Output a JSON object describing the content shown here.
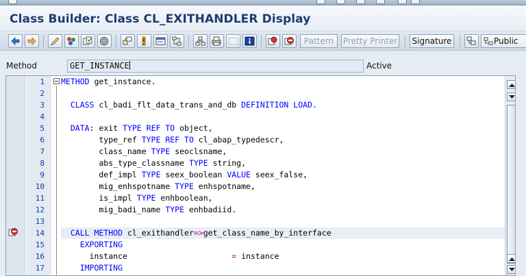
{
  "window": {
    "title": "Class Builder: Class CL_EXITHANDLER Display"
  },
  "toolbar": {
    "pattern_label": "Pattern",
    "pretty_printer_label": "Pretty Printer",
    "signature_label": "Signature",
    "public_label": "Public"
  },
  "method_row": {
    "label": "Method",
    "value": "GET_INSTANCE",
    "status": "Active"
  },
  "editor": {
    "current_line": 14,
    "lines": [
      {
        "no": "1",
        "segments": [
          {
            "t": "kw",
            "v": "METHOD"
          },
          {
            "t": "tx",
            "v": " get_instance."
          }
        ]
      },
      {
        "no": "2",
        "segments": []
      },
      {
        "no": "3",
        "segments": [
          {
            "t": "tx",
            "v": "  "
          },
          {
            "t": "kw",
            "v": "CLASS"
          },
          {
            "t": "tx",
            "v": " cl_badi_flt_data_trans_and_db "
          },
          {
            "t": "kw",
            "v": "DEFINITION LOAD"
          },
          {
            "t": "tx",
            "v": "."
          }
        ]
      },
      {
        "no": "4",
        "segments": []
      },
      {
        "no": "5",
        "segments": [
          {
            "t": "tx",
            "v": "  "
          },
          {
            "t": "kw",
            "v": "DATA"
          },
          {
            "t": "tx",
            "v": ": exit "
          },
          {
            "t": "kw",
            "v": "TYPE REF TO"
          },
          {
            "t": "tx",
            "v": " object,"
          }
        ]
      },
      {
        "no": "6",
        "segments": [
          {
            "t": "tx",
            "v": "        type_ref "
          },
          {
            "t": "kw",
            "v": "TYPE REF TO"
          },
          {
            "t": "tx",
            "v": " cl_abap_typedescr,"
          }
        ]
      },
      {
        "no": "7",
        "segments": [
          {
            "t": "tx",
            "v": "        class_name "
          },
          {
            "t": "kw",
            "v": "TYPE"
          },
          {
            "t": "tx",
            "v": " seoclsname,"
          }
        ]
      },
      {
        "no": "8",
        "segments": [
          {
            "t": "tx",
            "v": "        abs_type_classname "
          },
          {
            "t": "kw",
            "v": "TYPE"
          },
          {
            "t": "tx",
            "v": " string,"
          }
        ]
      },
      {
        "no": "9",
        "segments": [
          {
            "t": "tx",
            "v": "        def_impl "
          },
          {
            "t": "kw",
            "v": "TYPE"
          },
          {
            "t": "tx",
            "v": " seex_boolean "
          },
          {
            "t": "kw",
            "v": "VALUE"
          },
          {
            "t": "tx",
            "v": " seex_false,"
          }
        ]
      },
      {
        "no": "10",
        "segments": [
          {
            "t": "tx",
            "v": "        mig_enhspotname "
          },
          {
            "t": "kw",
            "v": "TYPE"
          },
          {
            "t": "tx",
            "v": " enhspotname,"
          }
        ]
      },
      {
        "no": "11",
        "segments": [
          {
            "t": "tx",
            "v": "        is_impl "
          },
          {
            "t": "kw",
            "v": "TYPE"
          },
          {
            "t": "tx",
            "v": " enhboolean,"
          }
        ]
      },
      {
        "no": "12",
        "segments": [
          {
            "t": "tx",
            "v": "        mig_badi_name "
          },
          {
            "t": "kw",
            "v": "TYPE"
          },
          {
            "t": "tx",
            "v": " enhbadiid."
          }
        ]
      },
      {
        "no": "13",
        "segments": []
      },
      {
        "no": "14",
        "segments": [
          {
            "t": "tx",
            "v": "  "
          },
          {
            "t": "kw",
            "v": "CALL METHOD"
          },
          {
            "t": "tx",
            "v": " cl_exithandler"
          },
          {
            "t": "op",
            "v": "=>"
          },
          {
            "t": "tx",
            "v": "get_class_name_by_interface"
          }
        ]
      },
      {
        "no": "15",
        "segments": [
          {
            "t": "tx",
            "v": "    "
          },
          {
            "t": "kw",
            "v": "EXPORTING"
          }
        ]
      },
      {
        "no": "16",
        "segments": [
          {
            "t": "tx",
            "v": "      instance                      "
          },
          {
            "t": "op",
            "v": "="
          },
          {
            "t": "tx",
            "v": " instance"
          }
        ]
      },
      {
        "no": "17",
        "segments": [
          {
            "t": "tx",
            "v": "    "
          },
          {
            "t": "kw",
            "v": "IMPORTING"
          }
        ]
      }
    ]
  },
  "colors": {
    "keyword": "#0000ff",
    "operator": "#c00090",
    "line_number": "#0a3da8",
    "title": "#1d3c6e"
  },
  "icons": [
    "back-arrow-icon",
    "forward-arrow-icon",
    "edit-pencil-icon",
    "other-object-icon",
    "check-icon",
    "activate-icon",
    "where-used-icon",
    "display-object-list-icon",
    "info-icon",
    "breakpoint-icon",
    "stop-icon",
    "print-icon",
    "find-icon",
    "help-icon"
  ]
}
